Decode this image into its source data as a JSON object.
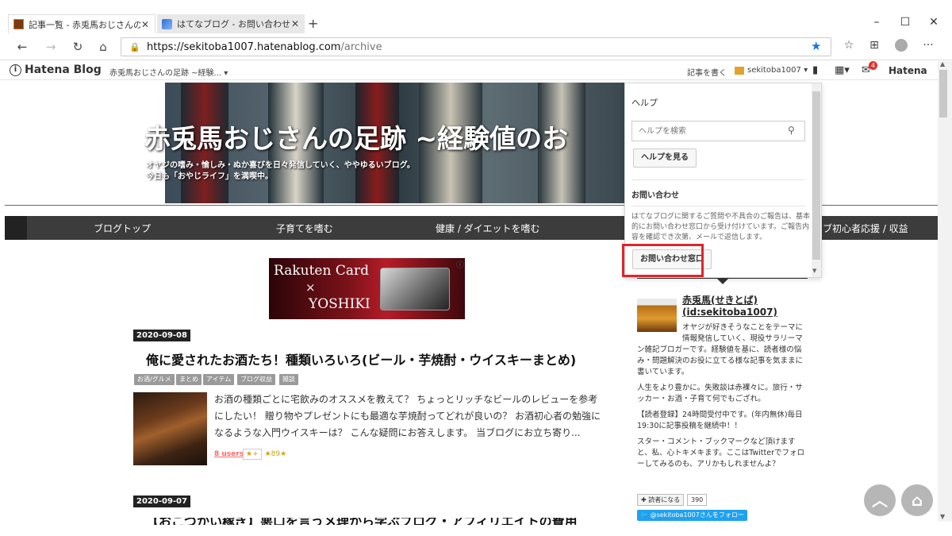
{
  "browser": {
    "tabs": [
      {
        "title": "記事一覧 - 赤兎馬おじさんの足跡",
        "active": true
      },
      {
        "title": "はてなブログ - お問い合わせ - はてな",
        "active": false
      }
    ],
    "new_tab": "+",
    "window_controls": {
      "minimize": "–",
      "maximize": "☐",
      "close": "✕"
    },
    "nav": {
      "back": "←",
      "forward": "→",
      "reload": "↻",
      "home": "⌂"
    },
    "url_host": "https://sekitoba1007.hatenablog.com",
    "url_path": "/archive",
    "star": "★",
    "toolbar_icons": [
      "favorites-icon",
      "collections-icon",
      "profile-icon",
      "more-icon"
    ],
    "more": "···"
  },
  "hatena_header": {
    "logo": "Hatena Blog",
    "logo_mark": "i",
    "blog_select": "赤兎馬おじさんの足跡 ~経験...  ▾",
    "write": "記事を書く",
    "user": "sekitoba1007 ▾",
    "notif_count": "4",
    "hatena": "Hatena"
  },
  "blog_header": {
    "title": "赤兎馬おじさんの足跡 ~経験値のお",
    "desc_line1": "オヤジの嗜み・愉しみ・ぬか喜びを日々発信していく、ややゆるいブログ。",
    "desc_line2": "今日も「おやじライフ」を満喫中。"
  },
  "global_nav": [
    "ブログトップ",
    "子育てを嗜む",
    "健康 / ダイエットを嗜む",
    "ブ初心者応援 / 収益"
  ],
  "ad": {
    "line1": "Rakuten Card",
    "line2": "×",
    "line3": "YOSHIKI",
    "info": "ⓘ"
  },
  "articles": [
    {
      "date": "2020-09-08",
      "title": "俺に愛されたお酒たち！種類いろいろ(ビール・芋焼酎・ウイスキーまとめ)",
      "tags": [
        "お酒/グルメ",
        "まとめ",
        "アイテム",
        "ブログ収益",
        "雑談"
      ],
      "excerpt": "お酒の種類ごとに宅飲みのオススメを教えて？ ちょっとリッチなビールのレビューを参考にしたい！ 贈り物やプレゼントにも最適な芋焼酎ってどれが良いの？ お酒初心者の勉強になるような入門ウイスキーは？ こんな疑問にお答えします。 当ブログにお立ち寄り...",
      "users": "8 users",
      "add_star": "★+",
      "stars": "★89★"
    },
    {
      "date": "2020-09-07",
      "title": "【おこづかい稼ぎ】悪口を言うメ理から学ぶブログ・アフィリエイトの費用"
    }
  ],
  "help_panel": {
    "heading": "ヘルプ",
    "search_placeholder": "ヘルプを検索",
    "search_icon": "🔍",
    "view_help": "ヘルプを見る",
    "contact_heading": "お問い合わせ",
    "contact_text": "はてなブログに関するご質問や不具合のご報告は、基本的にお問い合わせ窓口から受け付けています。ご報告内容を確認でき次第、メールで返信します。",
    "contact_button": "お問い合わせ窓口",
    "highlight_color": "#e0252b"
  },
  "profile": {
    "name": "赤兎馬(せきとば)",
    "id": "(id:sekitoba1007)",
    "bio_line1": "オヤジが好きそうなことをテーマに",
    "bio_line2": "情報発信していく、現役サラリーマ",
    "bio_rest": "ン雑記ブロガーです。経験値を基に、読者様の悩み・問題解決のお役に立てる様な記事を気ままに書いています。",
    "p2": "人生をより豊かに。失敗談は赤裸々に。旅行・サッカー・お酒・子育て何でもござれ。",
    "p3": "【読者登録】24時間受付中です。(年内無休)毎日19:30に記事投稿を継続中！！",
    "p4": "スター・コメント・ブックマークなど頂けますと、私、心トキメキます。ここはTwitterでフォローしてみるのも、アリかもしれませんよ？",
    "reader_button": "✚ 読者になる",
    "reader_count": "390",
    "twitter_button": "🐦 @sekitoba1007さんをフォロー"
  },
  "floating": {
    "up": "︿",
    "top": "⌂"
  },
  "scroll": {
    "up": "▲",
    "down": "▼"
  }
}
